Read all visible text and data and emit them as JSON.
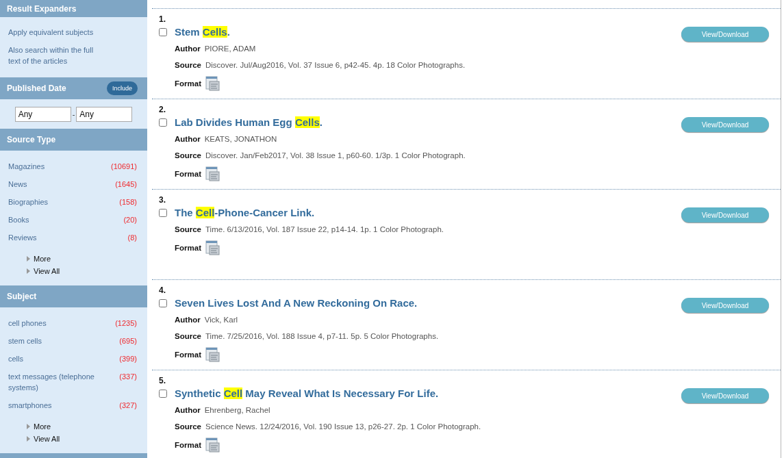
{
  "sidebar": {
    "sections": [
      {
        "title": "Result Expanders",
        "kind": "links",
        "items": [
          {
            "label": "Apply equivalent subjects"
          },
          {
            "label": "Also search within the full text of the articles"
          }
        ]
      },
      {
        "title": "Published Date",
        "kind": "date",
        "badge": "Include",
        "from": "Any",
        "separator": "-",
        "to": "Any"
      },
      {
        "title": "Source Type",
        "kind": "facets",
        "items": [
          {
            "label": "Magazines",
            "count": "(10691)"
          },
          {
            "label": "News",
            "count": "(1645)"
          },
          {
            "label": "Biographies",
            "count": "(158)"
          },
          {
            "label": "Books",
            "count": "(20)"
          },
          {
            "label": "Reviews",
            "count": "(8)"
          }
        ],
        "more": [
          "More",
          "View All"
        ]
      },
      {
        "title": "Subject",
        "kind": "facets",
        "items": [
          {
            "label": "cell phones",
            "count": "(1235)"
          },
          {
            "label": "stem cells",
            "count": "(695)"
          },
          {
            "label": "cells",
            "count": "(399)"
          },
          {
            "label": "text messages (telephone systems)",
            "count": "(337)"
          },
          {
            "label": "smartphones",
            "count": "(327)"
          }
        ],
        "more": [
          "More",
          "View All"
        ]
      }
    ]
  },
  "results": [
    {
      "number": "1.",
      "checked": false,
      "title": [
        {
          "text": "Stem ",
          "highlighted": false
        },
        {
          "text": "Cells",
          "highlighted": true
        },
        {
          "text": ".",
          "highlighted": false
        }
      ],
      "fields": [
        {
          "label": "Author",
          "value": "PIORE, ADAM"
        },
        {
          "label": "Source",
          "value": "Discover. Jul/Aug2016, Vol. 37 Issue 6, p42-45. 4p. 18 Color Photographs."
        }
      ],
      "format_label": "Format",
      "button": "View/Download"
    },
    {
      "number": "2.",
      "checked": false,
      "title": [
        {
          "text": "Lab Divides Human Egg ",
          "highlighted": false
        },
        {
          "text": "Cells",
          "highlighted": true
        },
        {
          "text": ".",
          "highlighted": false
        }
      ],
      "fields": [
        {
          "label": "Author",
          "value": "KEATS, JONATHON"
        },
        {
          "label": "Source",
          "value": "Discover. Jan/Feb2017, Vol. 38 Issue 1, p60-60. 1/3p. 1 Color Photograph."
        }
      ],
      "format_label": "Format",
      "button": "View/Download"
    },
    {
      "number": "3.",
      "checked": false,
      "title": [
        {
          "text": "The ",
          "highlighted": false
        },
        {
          "text": "Cell",
          "highlighted": true
        },
        {
          "text": "-Phone-Cancer Link.",
          "highlighted": false
        }
      ],
      "fields": [
        {
          "label": "Source",
          "value": "Time. 6/13/2016, Vol. 187 Issue 22, p14-14. 1p. 1 Color Photograph."
        }
      ],
      "format_label": "Format",
      "button": "View/Download"
    },
    {
      "number": "4.",
      "checked": false,
      "title": [
        {
          "text": "Seven Lives Lost And A New Reckoning On Race.",
          "highlighted": false
        }
      ],
      "fields": [
        {
          "label": "Author",
          "value": "Vick, Karl"
        },
        {
          "label": "Source",
          "value": "Time. 7/25/2016, Vol. 188 Issue 4, p7-11. 5p. 5 Color Photographs."
        }
      ],
      "format_label": "Format",
      "button": "View/Download"
    },
    {
      "number": "5.",
      "checked": false,
      "title": [
        {
          "text": "Synthetic ",
          "highlighted": false
        },
        {
          "text": "Cell",
          "highlighted": true
        },
        {
          "text": " May Reveal What Is Necessary For Life.",
          "highlighted": false
        }
      ],
      "fields": [
        {
          "label": "Author",
          "value": "Ehrenberg, Rachel"
        },
        {
          "label": "Source",
          "value": "Science News. 12/24/2016, Vol. 190 Issue 13, p26-27. 2p. 1 Color Photograph."
        }
      ],
      "format_label": "Format",
      "button": "View/Download"
    }
  ]
}
